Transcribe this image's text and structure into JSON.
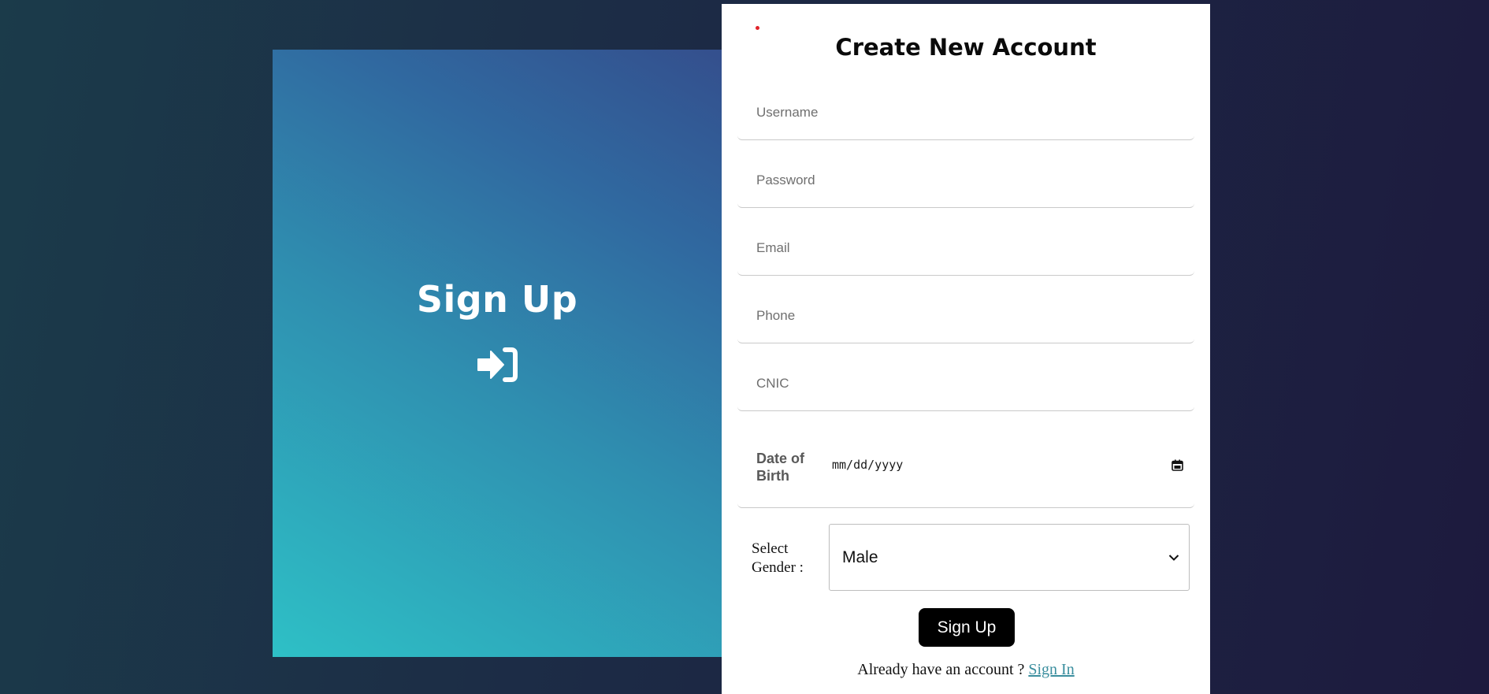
{
  "left_panel": {
    "title": "Sign Up",
    "icon": "sign-in-arrow-icon"
  },
  "form": {
    "title": "Create New Account",
    "fields": {
      "username": {
        "placeholder": "Username",
        "value": ""
      },
      "password": {
        "placeholder": "Password",
        "value": ""
      },
      "email": {
        "placeholder": "Email",
        "value": ""
      },
      "phone": {
        "placeholder": "Phone",
        "value": ""
      },
      "cnic": {
        "placeholder": "CNIC",
        "value": ""
      }
    },
    "dob": {
      "label": "Date of Birth",
      "placeholder": "mm/dd/yyyy",
      "icon": "calendar-icon"
    },
    "gender": {
      "label": "Select Gender :",
      "selected": "Male",
      "icon": "chevron-down-icon"
    },
    "submit_label": "Sign Up",
    "footer": {
      "prompt": "Already have an account ? ",
      "link_label": "Sign In"
    }
  },
  "colors": {
    "accent_link": "#3a8e9e",
    "button_bg": "#000000",
    "marker": "#e0242a"
  }
}
